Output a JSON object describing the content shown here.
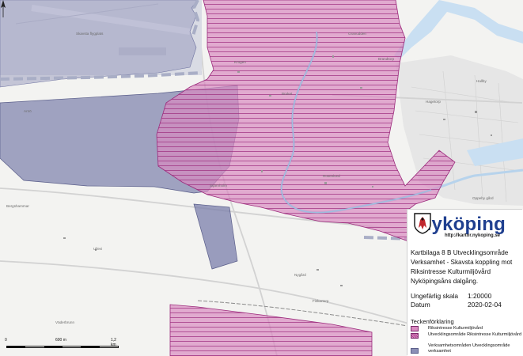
{
  "map": {
    "labels": [
      {
        "id": "lbl-skavsta",
        "text": "Skavsta flygplats"
      },
      {
        "id": "lbl-gran",
        "text": "Granudden"
      },
      {
        "id": "lbl-brandtorp",
        "text": "Brandtorp"
      },
      {
        "id": "lbl-hagetorp",
        "text": "Hagetorp"
      },
      {
        "id": "lbl-hallby",
        "text": "Hallby"
      },
      {
        "id": "lbl-oppeby",
        "text": "Oppeby gård"
      },
      {
        "id": "lbl-arnö",
        "text": "Arnö"
      },
      {
        "id": "lbl-vaderbrunn",
        "text": "Väderbrunn"
      },
      {
        "id": "lbl-ullevi",
        "text": "Ullevi"
      },
      {
        "id": "lbl-krogen",
        "text": "Krogen"
      },
      {
        "id": "lbl-bruket",
        "text": "Bruket"
      },
      {
        "id": "lbl-rosenlund",
        "text": "Rosenlund"
      },
      {
        "id": "lbl-stjarnholm",
        "text": "Stjärnholm"
      },
      {
        "id": "lbl-nygard",
        "text": "Nygård"
      },
      {
        "id": "lbl-fiskartorp",
        "text": "Fiskartorp"
      },
      {
        "id": "lbl-bergshammar",
        "text": "Bergshammar"
      }
    ]
  },
  "colors": {
    "cultural": "#d98ac0",
    "development": "#8b8fb6",
    "water": "#c9dff2"
  },
  "logo": {
    "name": "Nyköping",
    "url": "http://kartor.nykoping.se",
    "crest_icon": "nykoping-crest-icon"
  },
  "description": [
    "Kartbilaga 8 B Utvecklingsområde",
    "Verksamhet - Skavsta koppling mot",
    "Riksintresse Kulturmiljövård",
    "Nyköpingsåns dalgång."
  ],
  "meta": {
    "scale_label": "Ungefärlig skala",
    "scale_value": "1:20000",
    "date_label": "Datum",
    "date_value": "2020-02-04"
  },
  "legend": {
    "title": "Teckenförklaring",
    "items": [
      {
        "label": "Riksintresse Kulturmiljövård",
        "style": "cultural"
      },
      {
        "label": "Utvecklingsområde Riksintresse Kulturmiljövård",
        "style": "cultural-hatched"
      },
      {
        "label": "Verksamhetsområden Utvecklingsområde verksamhet",
        "style": "development"
      }
    ]
  },
  "scalebar": {
    "ticks": [
      "0",
      "600 m",
      "1,2 km"
    ]
  },
  "north_icon": "north-arrow-icon"
}
